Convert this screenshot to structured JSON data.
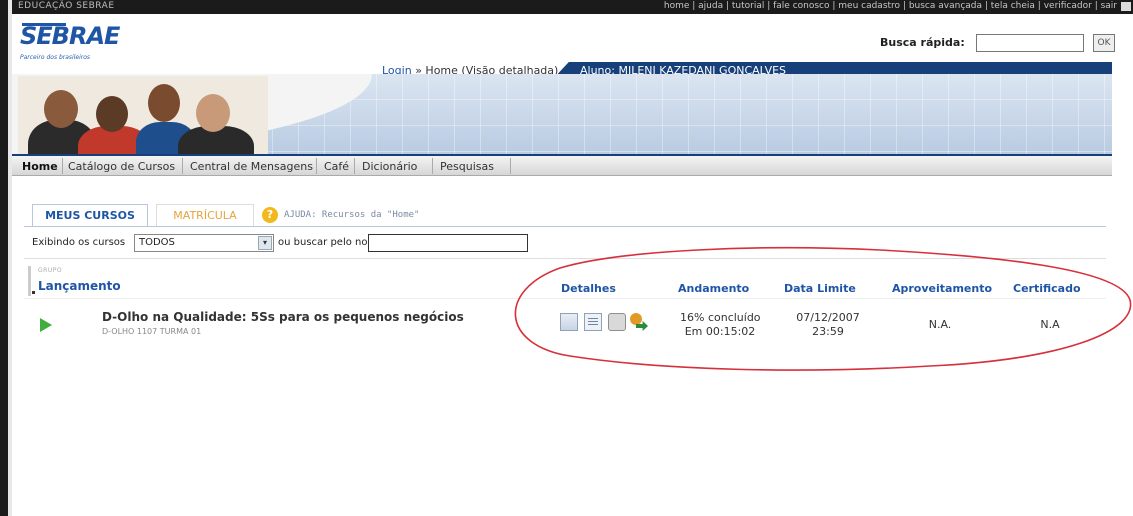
{
  "top": {
    "brand": "EDUCAÇÃO SEBRAE",
    "links": [
      "home",
      "ajuda",
      "tutorial",
      "fale conosco",
      "meu cadastro",
      "busca avançada",
      "tela cheia",
      "verificador",
      "sair"
    ]
  },
  "header": {
    "logo": "SEBRAE",
    "logo_tagline": "Parceiro dos brasileiros",
    "busca_label": "Busca rápida:",
    "busca_value": "",
    "ok_label": "OK",
    "breadcrumb_login": "Login",
    "breadcrumb_sep": "»",
    "breadcrumb_page": "Home (Visão detalhada)",
    "aluno": "Aluno: MILENI KAZEDANI GONÇALVES"
  },
  "nav": {
    "items": [
      "Home",
      "Catálogo de Cursos",
      "Central de Mensagens",
      "Café",
      "Dicionário",
      "Pesquisas"
    ]
  },
  "tabs": {
    "meus": "MEUS CURSOS",
    "matricula": "MATRÍCULA",
    "help_glyph": "?",
    "help": "AJUDA: Recursos da \"Home\""
  },
  "filter": {
    "label": "Exibindo os cursos",
    "selected": "TODOS",
    "arrow": "▾",
    "ou": "ou buscar pelo nome",
    "name_value": ""
  },
  "group": {
    "tag": "GRUPO",
    "title": "Lançamento"
  },
  "columns": {
    "detalhes": "Detalhes",
    "andamento": "Andamento",
    "data_limite": "Data Limite",
    "aproveitamento": "Aproveitamento",
    "certificado": "Certificado"
  },
  "course": {
    "title": "D-Olho na Qualidade: 5Ss para os pequenos negócios",
    "code": "D-OLHO 1107 TURMA 01",
    "progress_line1": "16% concluído",
    "progress_line2": "Em 00:15:02",
    "date_line1": "07/12/2007",
    "date_line2": "23:59",
    "aproveitamento": "N.A.",
    "certificado": "N.A"
  },
  "colors": {
    "brand_blue": "#1f55a5",
    "navy": "#17407a",
    "annotation_red": "#d6303a",
    "play_green": "#3fae3c",
    "matricula_orange": "#e9a23b"
  }
}
